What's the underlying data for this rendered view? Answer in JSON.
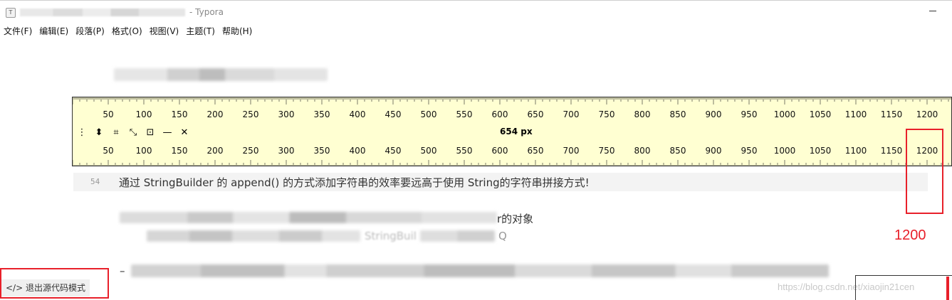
{
  "window": {
    "title_suffix": "- Typora",
    "app_icon_letter": "T"
  },
  "menu": [
    {
      "label": "文件(F)"
    },
    {
      "label": "编辑(E)"
    },
    {
      "label": "段落(P)"
    },
    {
      "label": "格式(O)"
    },
    {
      "label": "视图(V)"
    },
    {
      "label": "主题(T)"
    },
    {
      "label": "帮助(H)"
    }
  ],
  "ruler": {
    "ticks": [
      "50",
      "100",
      "150",
      "200",
      "250",
      "300",
      "350",
      "400",
      "450",
      "500",
      "550",
      "600",
      "650",
      "700",
      "750",
      "800",
      "850",
      "900",
      "950",
      "1000",
      "1050",
      "1100",
      "1150",
      "1200"
    ],
    "width_readout": "654 px",
    "background_color": "#ffffd2",
    "tools": [
      "move-icon",
      "resize-vertical-icon",
      "crop-icon",
      "diagonal-icon",
      "center-icon",
      "minimize-icon",
      "close-icon"
    ]
  },
  "editor": {
    "line_number": "54",
    "line_text": "通过 StringBuilder 的 append() 的方式添加字符串的效率要远高于使用 String的字符串拼接方式!",
    "line2_visible_tail": "r的对象",
    "line3_visible_part": "StringBuil",
    "line3_tail": "Q",
    "line4_prefix": "–"
  },
  "annotation": {
    "label": "1200",
    "color": "#e8202a"
  },
  "statusbar": {
    "source_mode_label": "退出源代码模式",
    "source_mode_icon": "code-icon"
  },
  "watermark": "https://blog.csdn.net/xiaojin21cen"
}
